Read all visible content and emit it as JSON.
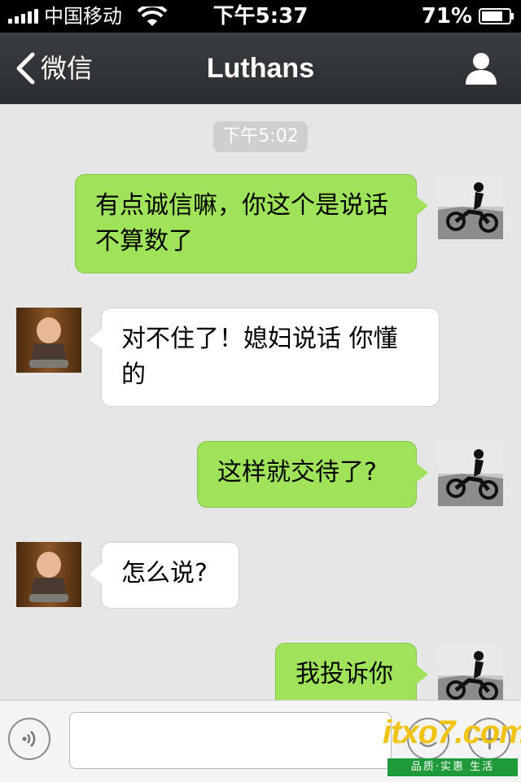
{
  "status_bar": {
    "carrier": "中国移动",
    "time": "下午5:37",
    "battery": "71%"
  },
  "nav": {
    "back_label": "微信",
    "title": "Luthans"
  },
  "chat": {
    "timestamp": "下午5:02",
    "messages": [
      {
        "direction": "out",
        "text": "有点诚信嘛，你这个是说话不算数了"
      },
      {
        "direction": "in",
        "text": "对不住了！媳妇说话 你懂的"
      },
      {
        "direction": "out",
        "text": "这样就交待了?"
      },
      {
        "direction": "in",
        "text": "怎么说?"
      },
      {
        "direction": "out",
        "text": "我投诉你"
      }
    ]
  },
  "input": {
    "placeholder": ""
  },
  "watermark": {
    "logo": "itxo7.com",
    "tagline": "品质·实惠 生活"
  },
  "colors": {
    "outgoing_bubble": "#9fe35b",
    "incoming_bubble": "#ffffff",
    "chat_background": "#e6e6e6",
    "nav_background": "#2f3235"
  },
  "icons": [
    "signal-icon",
    "wifi-icon",
    "battery-icon",
    "back-chevron-icon",
    "profile-icon",
    "voice-icon",
    "emoji-icon",
    "plus-icon"
  ]
}
